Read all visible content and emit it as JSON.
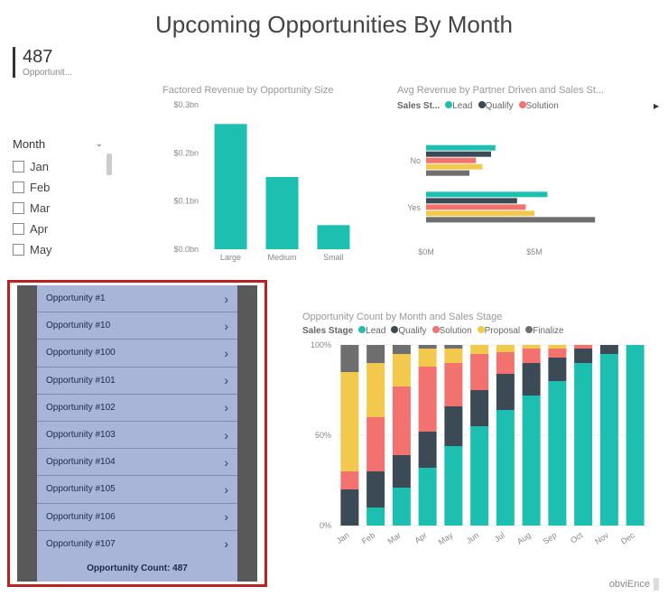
{
  "title": "Upcoming Opportunities By Month",
  "kpi": {
    "value": "487",
    "label": "Opportunit..."
  },
  "slicer": {
    "title": "Month",
    "items": [
      "Jan",
      "Feb",
      "Mar",
      "Apr",
      "May"
    ]
  },
  "colors": {
    "lead": "#1cbfb0",
    "qualify": "#3b4a54",
    "solution": "#f2726f",
    "proposal": "#f2c94c",
    "finalize": "#6e6e6e"
  },
  "chart_data": [
    {
      "id": "factored_revenue",
      "type": "bar",
      "title": "Factored Revenue by Opportunity Size",
      "categories": [
        "Large",
        "Medium",
        "Small"
      ],
      "values": [
        0.26,
        0.15,
        0.05
      ],
      "ylabel": "",
      "xlabel": "",
      "ylim": [
        0,
        0.3
      ],
      "y_ticks": [
        "$0.0bn",
        "$0.1bn",
        "$0.2bn",
        "$0.3bn"
      ]
    },
    {
      "id": "avg_revenue",
      "type": "bar",
      "orientation": "horizontal",
      "title": "Avg Revenue by Partner Driven and Sales St...",
      "legend_title": "Sales St...",
      "categories": [
        "No",
        "Yes"
      ],
      "series": [
        {
          "name": "Lead",
          "color": "#1cbfb0",
          "values": [
            3.2,
            5.6
          ]
        },
        {
          "name": "Qualify",
          "color": "#3b4a54",
          "values": [
            3.0,
            4.2
          ]
        },
        {
          "name": "Solution",
          "color": "#f2726f",
          "values": [
            2.3,
            4.6
          ]
        },
        {
          "name": "Proposal",
          "color": "#f2c94c",
          "values": [
            2.6,
            5.0
          ]
        },
        {
          "name": "Finalize",
          "color": "#6e6e6e",
          "values": [
            2.0,
            7.8
          ]
        }
      ],
      "xlim": [
        0,
        10
      ],
      "x_ticks": [
        "$0M",
        "$5M"
      ]
    },
    {
      "id": "count_by_month_stage",
      "type": "bar",
      "stacked": true,
      "percent": true,
      "title": "Opportunity Count by Month and Sales Stage",
      "legend_title": "Sales Stage",
      "categories": [
        "Jan",
        "Feb",
        "Mar",
        "Apr",
        "May",
        "Jun",
        "Jul",
        "Aug",
        "Sep",
        "Oct",
        "Nov",
        "Dec"
      ],
      "series": [
        {
          "name": "Lead",
          "color": "#1cbfb0",
          "values": [
            0,
            10,
            21,
            32,
            44,
            55,
            64,
            72,
            80,
            90,
            95,
            100,
            100
          ]
        },
        {
          "name": "Qualify",
          "color": "#3b4a54",
          "values": [
            20,
            20,
            18,
            20,
            22,
            20,
            20,
            18,
            13,
            8,
            5,
            0,
            0
          ]
        },
        {
          "name": "Solution",
          "color": "#f2726f",
          "values": [
            10,
            30,
            38,
            36,
            24,
            20,
            12,
            8,
            5,
            2,
            0,
            0,
            0
          ]
        },
        {
          "name": "Proposal",
          "color": "#f2c94c",
          "values": [
            55,
            30,
            18,
            10,
            8,
            5,
            4,
            2,
            2,
            0,
            0,
            0,
            0
          ]
        },
        {
          "name": "Finalize",
          "color": "#6e6e6e",
          "values": [
            15,
            10,
            5,
            2,
            2,
            0,
            0,
            0,
            0,
            0,
            0,
            0,
            0
          ]
        }
      ],
      "y_ticks": [
        "0%",
        "50%",
        "100%"
      ],
      "ylim": [
        0,
        100
      ]
    }
  ],
  "opp_list": {
    "items": [
      "Opportunity #1",
      "Opportunity #10",
      "Opportunity #100",
      "Opportunity #101",
      "Opportunity #102",
      "Opportunity #103",
      "Opportunity #104",
      "Opportunity #105",
      "Opportunity #106",
      "Opportunity #107"
    ],
    "footer": "Opportunity Count: 487"
  },
  "brand": "obviEnce"
}
